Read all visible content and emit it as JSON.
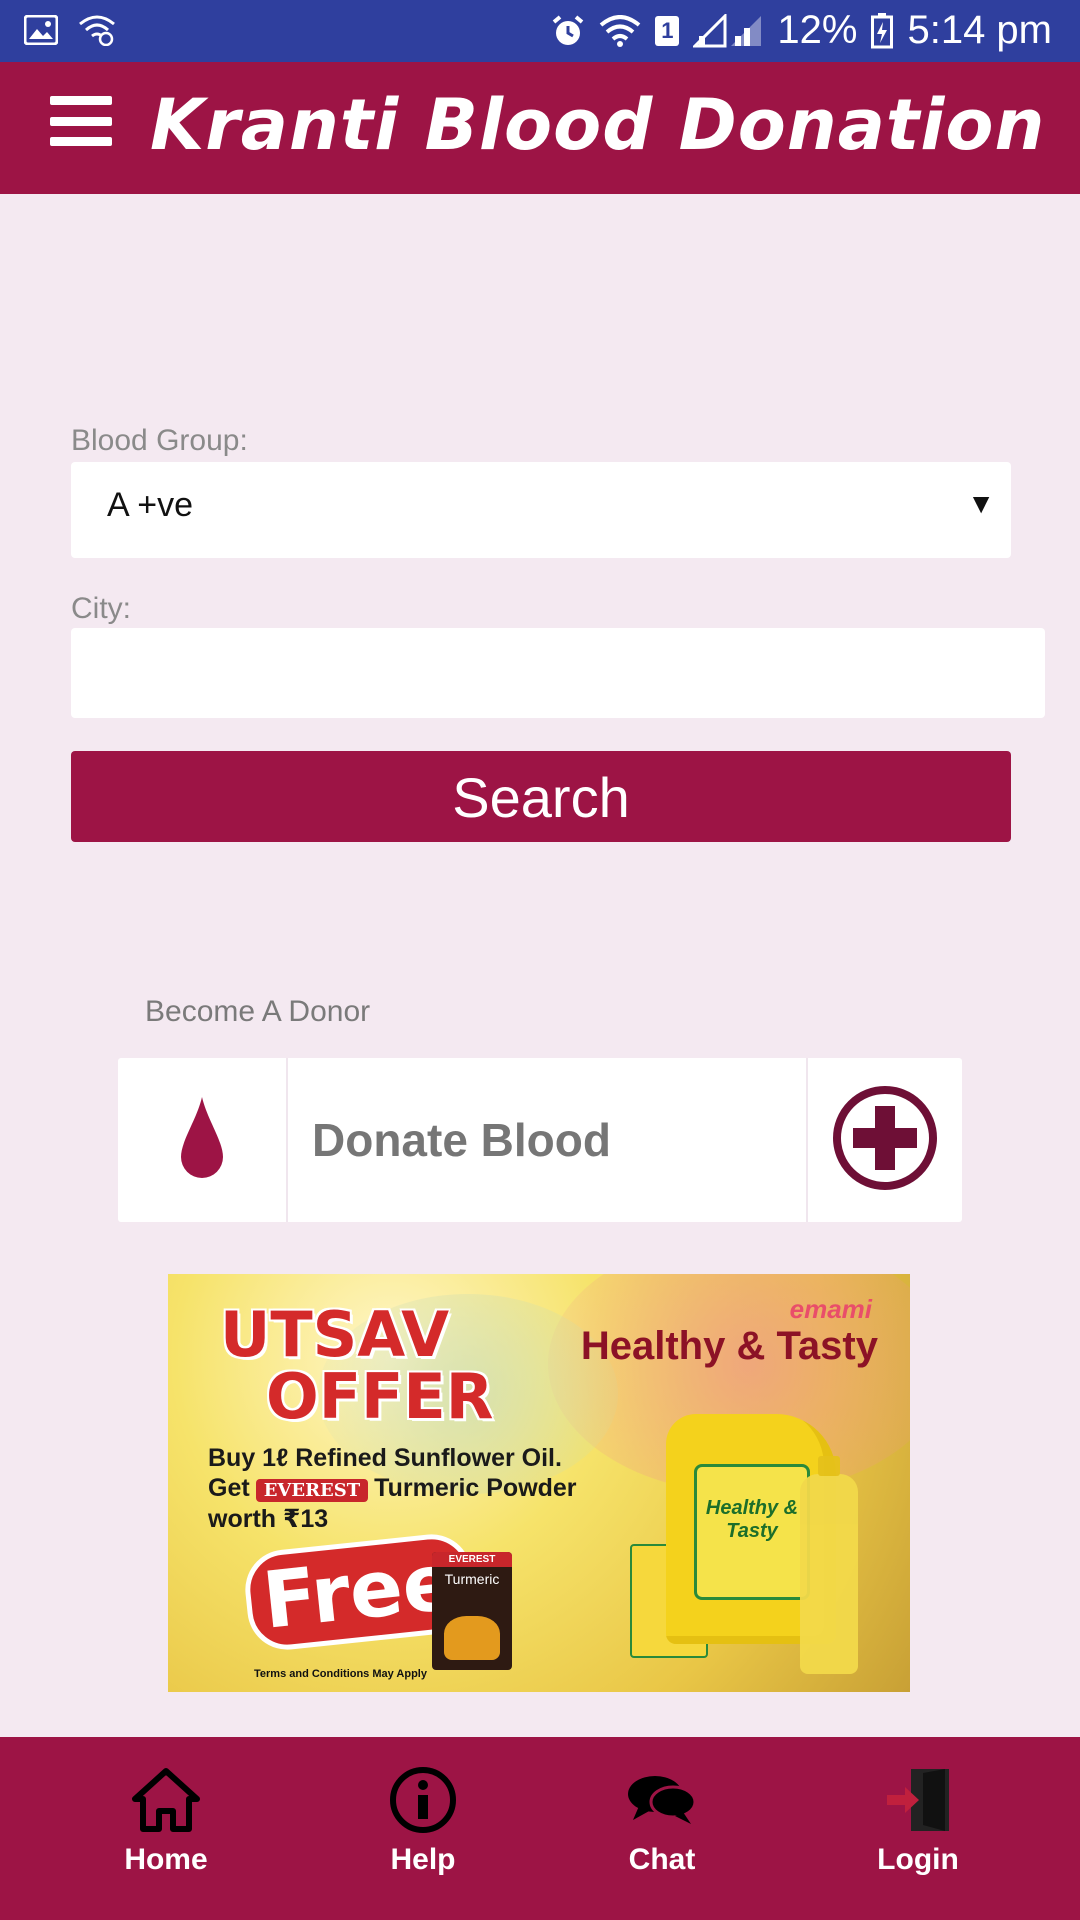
{
  "status_bar": {
    "battery_percent": "12%",
    "time": "5:14 pm",
    "sim_slot": "1",
    "icons": [
      "gallery-icon",
      "wifi-calling-icon",
      "alarm-icon",
      "wifi-icon",
      "sim-icon",
      "signal-icon",
      "battery-charging-icon"
    ]
  },
  "app_bar": {
    "title": "Kranti Blood Donation",
    "menu_icon": "hamburger-menu-icon"
  },
  "search_form": {
    "blood_group_label": "Blood Group:",
    "blood_group_value": "A +ve",
    "city_label": "City:",
    "city_value": "",
    "city_placeholder": "",
    "search_button_label": "Search"
  },
  "donor_section": {
    "heading": "Become A Donor",
    "card_label": "Donate Blood",
    "left_icon": "blood-drop-icon",
    "right_icon": "plus-circle-icon"
  },
  "advertisement": {
    "title_line1": "UTSAV",
    "title_line2": "OFFER",
    "brand": "emami",
    "headline": "Healthy & Tasty",
    "line1": "Buy 1ℓ Refined Sunflower Oil.",
    "line2_prefix": "Get",
    "line2_brand": "EVEREST",
    "line2_suffix": "Turmeric Powder",
    "line3": "worth  ₹13",
    "free_text": "Free",
    "pack_brand": "EVEREST",
    "pack_name": "Turmeric",
    "product_label": "Healthy & Tasty",
    "terms": "Terms and Conditions May Apply"
  },
  "bottom_nav": {
    "items": [
      {
        "label": "Home",
        "icon": "home-icon"
      },
      {
        "label": "Help",
        "icon": "info-icon"
      },
      {
        "label": "Chat",
        "icon": "chat-bubbles-icon"
      },
      {
        "label": "Login",
        "icon": "login-door-icon"
      }
    ]
  },
  "colors": {
    "status_bar": "#2f3f9e",
    "primary": "#9d1445",
    "background": "#f4e9f1",
    "card": "#ffffff"
  }
}
